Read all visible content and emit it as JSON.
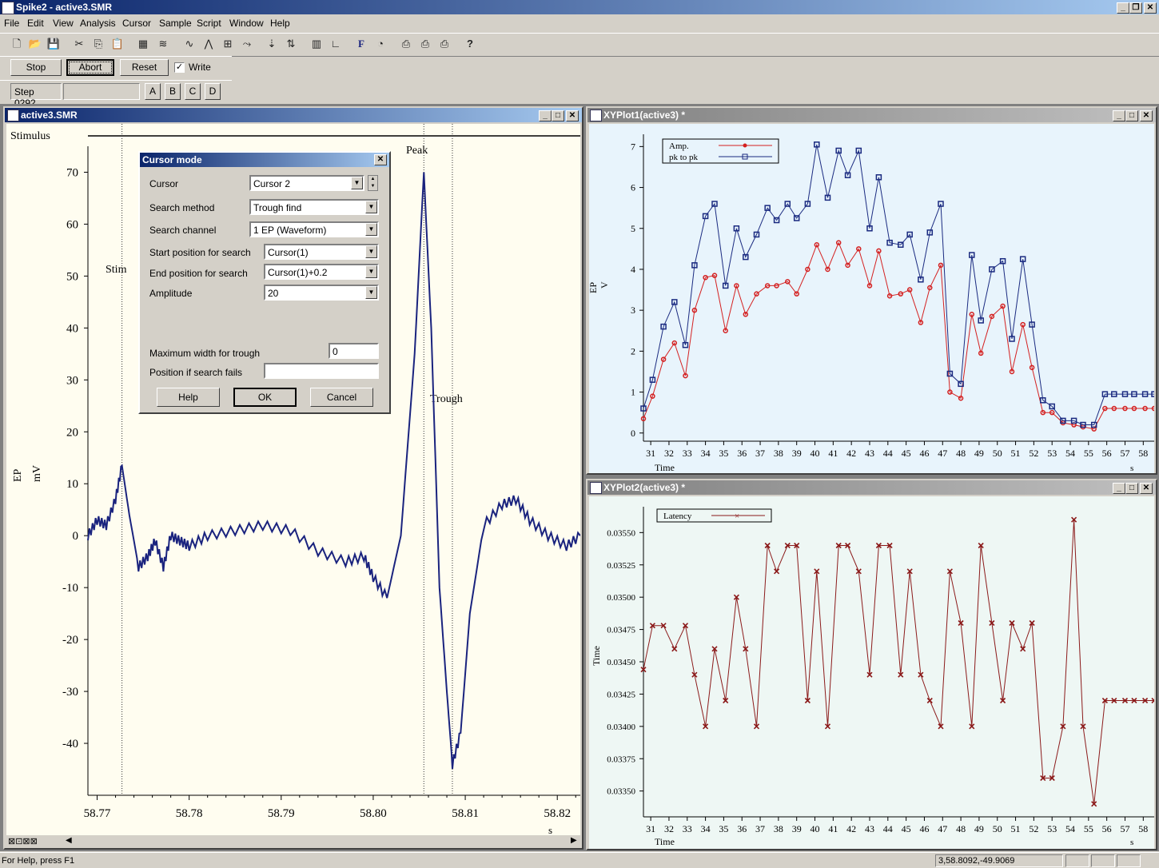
{
  "app": {
    "title": "Spike2 - active3.SMR",
    "menus": [
      "File",
      "Edit",
      "View",
      "Analysis",
      "Cursor",
      "Sample",
      "Script",
      "Window",
      "Help"
    ]
  },
  "toolbar2": {
    "stop": "Stop",
    "abort": "Abort",
    "reset": "Reset",
    "write": "Write"
  },
  "toolbar3": {
    "step": "Step  0292",
    "a": "A",
    "b": "B",
    "c": "C",
    "d": "D"
  },
  "status": {
    "help": "For Help, press F1",
    "coords": "3,58.8092,-49.9069"
  },
  "window1": {
    "title": "active3.SMR",
    "stimulus_label": "Stimulus",
    "stim_label": "Stim",
    "peak_label": "Peak",
    "trough_label": "Trough",
    "ylabel": "EP",
    "yunit": "mV",
    "xunit": "s"
  },
  "dialog": {
    "title": "Cursor mode",
    "cursor_label": "Cursor",
    "cursor_value": "Cursor 2",
    "method_label": "Search method",
    "method_value": "Trough find",
    "channel_label": "Search channel",
    "channel_value": "1 EP (Waveform)",
    "start_label": "Start position for search",
    "start_value": "Cursor(1)",
    "end_label": "End position for search",
    "end_value": "Cursor(1)+0.2",
    "amp_label": "Amplitude",
    "amp_value": "20",
    "maxw_label": "Maximum width for trough",
    "maxw_value": "0",
    "fail_label": "Position if search fails",
    "fail_value": "",
    "help": "Help",
    "ok": "OK",
    "cancel": "Cancel"
  },
  "window2": {
    "title": "XYPlot1(active3) *",
    "ylabel": "EP",
    "yunit": "V",
    "xlabel": "Time",
    "xunit": "s"
  },
  "window3": {
    "title": "XYPlot2(active3) *",
    "ylabel": "Time",
    "xlabel": "Time",
    "xunit": "s"
  },
  "colors": {
    "amp": "#d42020",
    "pk": "#1a2a80",
    "latency": "#8b1a1a",
    "wave": "#1a237e"
  },
  "chart_data": [
    {
      "type": "line",
      "name": "waveform",
      "ylim": [
        -50,
        75
      ],
      "xlim": [
        58.769,
        58.8225
      ],
      "x_ticks": [
        "58.77",
        "58.78",
        "58.79",
        "58.80",
        "58.81",
        "58.82"
      ],
      "y_ticks": [
        70,
        60,
        50,
        40,
        30,
        20,
        10,
        0,
        -10,
        -20,
        -30,
        -40
      ],
      "cursors": [
        58.7727,
        58.8055,
        58.8086
      ],
      "x": [
        58.769,
        58.77,
        58.771,
        58.772,
        58.7727,
        58.7735,
        58.7745,
        58.7755,
        58.7763,
        58.7772,
        58.778,
        58.779,
        58.78,
        58.782,
        58.785,
        58.788,
        58.791,
        58.794,
        58.797,
        58.799,
        58.8,
        58.8015,
        58.803,
        58.8045,
        58.8055,
        58.8063,
        58.8072,
        58.808,
        58.8086,
        58.8095,
        58.8105,
        58.812,
        58.814,
        58.8155,
        58.817,
        58.819,
        58.821,
        58.8225
      ],
      "y": [
        0,
        3,
        2,
        7,
        13.5,
        4,
        -6,
        -4,
        -1,
        -6,
        0,
        -1,
        -2,
        0,
        1,
        2,
        1,
        -3,
        -5,
        -4,
        -8,
        -12,
        0,
        35,
        70,
        40,
        -10,
        -30,
        -44,
        -38,
        -15,
        2,
        6,
        7,
        3,
        0,
        -2,
        0
      ]
    },
    {
      "type": "line",
      "xlim": [
        30.6,
        58.6
      ],
      "ylim": [
        -0.2,
        7.3
      ],
      "categories": [
        30.6,
        31.1,
        31.7,
        32.3,
        32.9,
        33.4,
        34.0,
        34.5,
        35.1,
        35.7,
        36.2,
        36.8,
        37.4,
        37.9,
        38.5,
        39.0,
        39.6,
        40.1,
        40.7,
        41.3,
        41.8,
        42.4,
        43.0,
        43.5,
        44.1,
        44.7,
        45.2,
        45.8,
        46.3,
        46.9,
        47.4,
        48.0,
        48.6,
        49.1,
        49.7,
        50.3,
        50.8,
        51.4,
        51.9,
        52.5,
        53.0,
        53.6,
        54.2,
        54.7,
        55.3,
        55.9,
        56.4,
        57.0,
        57.5,
        58.1,
        58.6
      ],
      "series": [
        {
          "name": "Amp.",
          "values": [
            0.35,
            0.9,
            1.8,
            2.2,
            1.4,
            3.0,
            3.8,
            3.85,
            2.5,
            3.6,
            2.9,
            3.4,
            3.6,
            3.6,
            3.7,
            3.4,
            4.0,
            4.6,
            4.0,
            4.65,
            4.1,
            4.5,
            3.6,
            4.45,
            3.35,
            3.4,
            3.5,
            2.7,
            3.55,
            4.1,
            1.0,
            0.85,
            2.9,
            1.95,
            2.85,
            3.1,
            1.5,
            2.65,
            1.6,
            0.5,
            0.5,
            0.25,
            0.2,
            0.15,
            0.1,
            0.6,
            0.6,
            0.6,
            0.6,
            0.6,
            0.6
          ]
        },
        {
          "name": "pk to pk",
          "values": [
            0.6,
            1.3,
            2.6,
            3.2,
            2.15,
            4.1,
            5.3,
            5.6,
            3.6,
            5.0,
            4.3,
            4.85,
            5.5,
            5.2,
            5.6,
            5.25,
            5.6,
            7.05,
            5.75,
            6.9,
            6.3,
            6.9,
            5.0,
            6.25,
            4.65,
            4.6,
            4.85,
            3.75,
            4.9,
            5.6,
            1.45,
            1.2,
            4.35,
            2.75,
            4.0,
            4.2,
            2.3,
            4.25,
            2.65,
            0.8,
            0.65,
            0.3,
            0.3,
            0.2,
            0.2,
            0.95,
            0.95,
            0.95,
            0.95,
            0.95,
            0.95
          ]
        }
      ],
      "x_ticks": [
        31,
        32,
        33,
        34,
        35,
        36,
        37,
        38,
        39,
        40,
        41,
        42,
        43,
        44,
        45,
        46,
        47,
        48,
        49,
        50,
        51,
        52,
        53,
        54,
        55,
        56,
        57,
        58
      ],
      "y_ticks": [
        0,
        1,
        2,
        3,
        4,
        5,
        6,
        7
      ]
    },
    {
      "type": "line",
      "xlim": [
        30.6,
        58.6
      ],
      "ylim": [
        0.0333,
        0.0357
      ],
      "x": [
        30.6,
        31.1,
        31.7,
        32.3,
        32.9,
        33.4,
        34.0,
        34.5,
        35.1,
        35.7,
        36.2,
        36.8,
        37.4,
        37.9,
        38.5,
        39.0,
        39.6,
        40.1,
        40.7,
        41.3,
        41.8,
        42.4,
        43.0,
        43.5,
        44.1,
        44.7,
        45.2,
        45.8,
        46.3,
        46.9,
        47.4,
        48.0,
        48.6,
        49.1,
        49.7,
        50.3,
        50.8,
        51.4,
        51.9,
        52.5,
        53.0,
        53.6,
        54.2,
        54.7,
        55.3,
        55.9,
        56.4,
        57.0,
        57.5,
        58.1,
        58.6
      ],
      "series": [
        {
          "name": "Latency",
          "values": [
            0.03444,
            0.03478,
            0.03478,
            0.0346,
            0.03478,
            0.0344,
            0.034,
            0.0346,
            0.0342,
            0.035,
            0.0346,
            0.034,
            0.0354,
            0.0352,
            0.0354,
            0.0354,
            0.0342,
            0.0352,
            0.034,
            0.0354,
            0.0354,
            0.0352,
            0.0344,
            0.0354,
            0.0354,
            0.0344,
            0.0352,
            0.0344,
            0.0342,
            0.034,
            0.0352,
            0.0348,
            0.034,
            0.0354,
            0.0348,
            0.0342,
            0.0348,
            0.0346,
            0.0348,
            0.0336,
            0.0336,
            0.034,
            0.0356,
            0.034,
            0.0334,
            0.0342,
            0.0342,
            0.0342,
            0.0342,
            0.0342,
            0.0342
          ]
        }
      ],
      "x_ticks": [
        31,
        32,
        33,
        34,
        35,
        36,
        37,
        38,
        39,
        40,
        41,
        42,
        43,
        44,
        45,
        46,
        47,
        48,
        49,
        50,
        51,
        52,
        53,
        54,
        55,
        56,
        57,
        58
      ],
      "y_ticks": [
        "0.03550",
        "0.03525",
        "0.03500",
        "0.03475",
        "0.03450",
        "0.03425",
        "0.03400",
        "0.03375",
        "0.03350"
      ]
    }
  ]
}
